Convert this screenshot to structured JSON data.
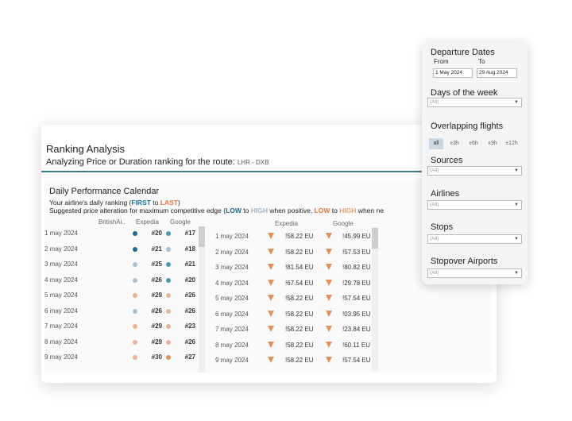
{
  "main": {
    "title": "Ranking Analysis",
    "subtitle": "Analyzing Price or Duration ranking for the route:",
    "route": "LHR - DXB"
  },
  "calendar": {
    "title": "Daily Performance Calendar",
    "desc1_prefix": "Your airline's daily ranking (",
    "first": "FIRST",
    "to": " to ",
    "last": "LAST",
    "desc1_suffix": ")",
    "desc2_prefix": "Suggested price alteration for maximum competitive edge (",
    "low": "LOW",
    "to2": " to ",
    "high": "HIGH",
    "mid": " when positive, ",
    "low2": "LOW",
    "to3": " to ",
    "high2": "HIGH",
    "desc2_suffix": " when ne",
    "rank_headers": [
      "BritishAi..",
      "Expedia",
      "Google"
    ],
    "price_headers": [
      "Expedia",
      "Google"
    ],
    "colors": {
      "dark_blue": "#1f6a86",
      "mid_blue": "#4a9bb1",
      "light_blue": "#a9c2d1",
      "light_orange": "#e8b39a",
      "orange": "#e2915c"
    },
    "rows": [
      {
        "date": "1 may 2024",
        "exp_rank": "#20",
        "goo_rank": "#17",
        "exp_color": "#1f6a86",
        "goo_color": "#4a9bb1"
      },
      {
        "date": "2 may 2024",
        "exp_rank": "#21",
        "goo_rank": "#18",
        "exp_color": "#1f6a86",
        "goo_color": "#a9c2d1"
      },
      {
        "date": "3 may 2024",
        "exp_rank": "#25",
        "goo_rank": "#21",
        "exp_color": "#a9c2d1",
        "goo_color": "#4a9bb1"
      },
      {
        "date": "4 may 2024",
        "exp_rank": "#26",
        "goo_rank": "#20",
        "exp_color": "#a9c2d1",
        "goo_color": "#4a9bb1"
      },
      {
        "date": "5 may 2024",
        "exp_rank": "#29",
        "goo_rank": "#26",
        "exp_color": "#e8b39a",
        "goo_color": "#e8b39a"
      },
      {
        "date": "6 may 2024",
        "exp_rank": "#26",
        "goo_rank": "#26",
        "exp_color": "#a9c2d1",
        "goo_color": "#e8b39a"
      },
      {
        "date": "7 may 2024",
        "exp_rank": "#29",
        "goo_rank": "#23",
        "exp_color": "#e8b39a",
        "goo_color": "#e8b39a"
      },
      {
        "date": "8 may 2024",
        "exp_rank": "#29",
        "goo_rank": "#26",
        "exp_color": "#e8b39a",
        "goo_color": "#e8b39a"
      },
      {
        "date": "9 may 2024",
        "exp_rank": "#30",
        "goo_rank": "#27",
        "exp_color": "#e8b39a",
        "goo_color": "#e2915c"
      }
    ],
    "price_rows": [
      {
        "date": "1 may 2024",
        "exp": "!58.22 EU",
        "goo": "!45.99 EU"
      },
      {
        "date": "2 may 2024",
        "exp": "!58.22 EU",
        "goo": "!57.53 EU"
      },
      {
        "date": "3 may 2024",
        "exp": "!81.54 EU",
        "goo": "!80.82 EU"
      },
      {
        "date": "4 may 2024",
        "exp": "!67.54 EU",
        "goo": "!29.78 EU"
      },
      {
        "date": "5 may 2024",
        "exp": "!58.22 EU",
        "goo": "!57.54 EU"
      },
      {
        "date": "6 may 2024",
        "exp": "!58.22 EU",
        "goo": "!03.95 EU"
      },
      {
        "date": "7 may 2024",
        "exp": "!58.22 EU",
        "goo": "!23.84 EU"
      },
      {
        "date": "8 may 2024",
        "exp": "!58.22 EU",
        "goo": "!60.11 EU"
      },
      {
        "date": "9 may 2024",
        "exp": "!58.22 EU",
        "goo": "!57.54 EU"
      }
    ]
  },
  "filters": {
    "departure_title": "Departure Dates",
    "from_label": "From",
    "to_label": "To",
    "from_value": "1 May 2024",
    "to_value": "29 Aug 2024",
    "days_title": "Days of the week",
    "days_value": "(All)",
    "overlap_title": "Overlapping flights",
    "overlap_options": [
      "all",
      "±3h",
      "±6h",
      "±9h",
      "±12h"
    ],
    "sources_title": "Sources",
    "sources_value": "(All)",
    "airlines_title": "Airlines",
    "airlines_value": "(All)",
    "stops_title": "Stops",
    "stops_value": "(All)",
    "stopover_title": "Stopover Airports",
    "stopover_value": "(All)"
  }
}
